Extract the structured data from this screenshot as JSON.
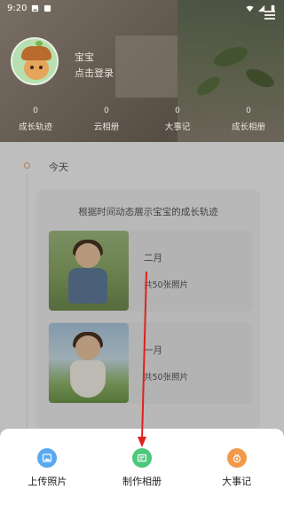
{
  "status_bar": {
    "time": "9:20"
  },
  "profile": {
    "name": "宝宝",
    "login_prompt": "点击登录"
  },
  "stats": [
    {
      "count": "0",
      "label": "成长轨迹"
    },
    {
      "count": "0",
      "label": "云相册"
    },
    {
      "count": "0",
      "label": "大事记"
    },
    {
      "count": "0",
      "label": "成长相册"
    }
  ],
  "timeline": {
    "section_label": "今天"
  },
  "card": {
    "title": "根据时间动态展示宝宝的成长轨迹",
    "albums": [
      {
        "month": "二月",
        "count": "共50张照片"
      },
      {
        "month": "一月",
        "count": "共50张照片"
      }
    ]
  },
  "bottom_sheet": {
    "actions": [
      {
        "label": "上传照片",
        "icon": "photo-upload-icon",
        "color": "#5aa9f0"
      },
      {
        "label": "制作相册",
        "icon": "album-make-icon",
        "color": "#4cc87c"
      },
      {
        "label": "大事记",
        "icon": "milestone-icon",
        "color": "#f29a4a"
      }
    ]
  },
  "colors": {
    "annotation_arrow": "#e0201b"
  }
}
